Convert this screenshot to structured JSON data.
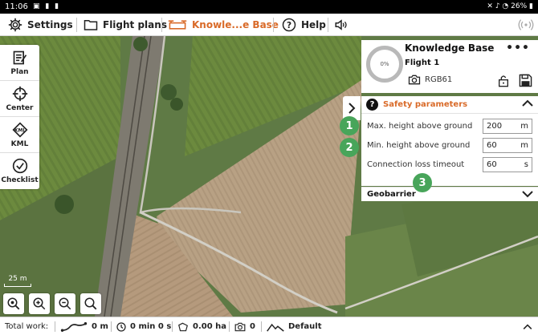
{
  "status_bar": {
    "time": "11:06",
    "battery": "26%"
  },
  "toolbar": {
    "settings": "Settings",
    "flight_plans": "Flight plans",
    "knowledge_base": "Knowle...e Base",
    "help": "Help"
  },
  "tools": {
    "plan": "Plan",
    "center": "Center",
    "kml": "KML",
    "checklist": "Checklist"
  },
  "map": {
    "scale_label": "25 m"
  },
  "project": {
    "title": "Knowledge Base",
    "flight": "Flight 1",
    "progress_label": "0%",
    "progress": 0,
    "sensor": "RGB61",
    "more": "•••"
  },
  "safety": {
    "title": "Safety parameters",
    "rows": [
      {
        "label": "Max. height above ground",
        "value": "200",
        "unit": "m"
      },
      {
        "label": "Min. height above ground",
        "value": "60",
        "unit": "m"
      },
      {
        "label": "Connection loss timeout",
        "value": "60",
        "unit": "s"
      }
    ]
  },
  "geobarrier": {
    "title": "Geobarrier"
  },
  "steps": [
    "1",
    "2",
    "3"
  ],
  "bottom": {
    "total_work_label": "Total work:",
    "distance": "0 m",
    "time": "0 min 0 s",
    "area": "0.00 ha",
    "photos": "0",
    "terrain": "Default"
  },
  "colors": {
    "accent": "#d96a28",
    "step_green": "#48a55a"
  }
}
